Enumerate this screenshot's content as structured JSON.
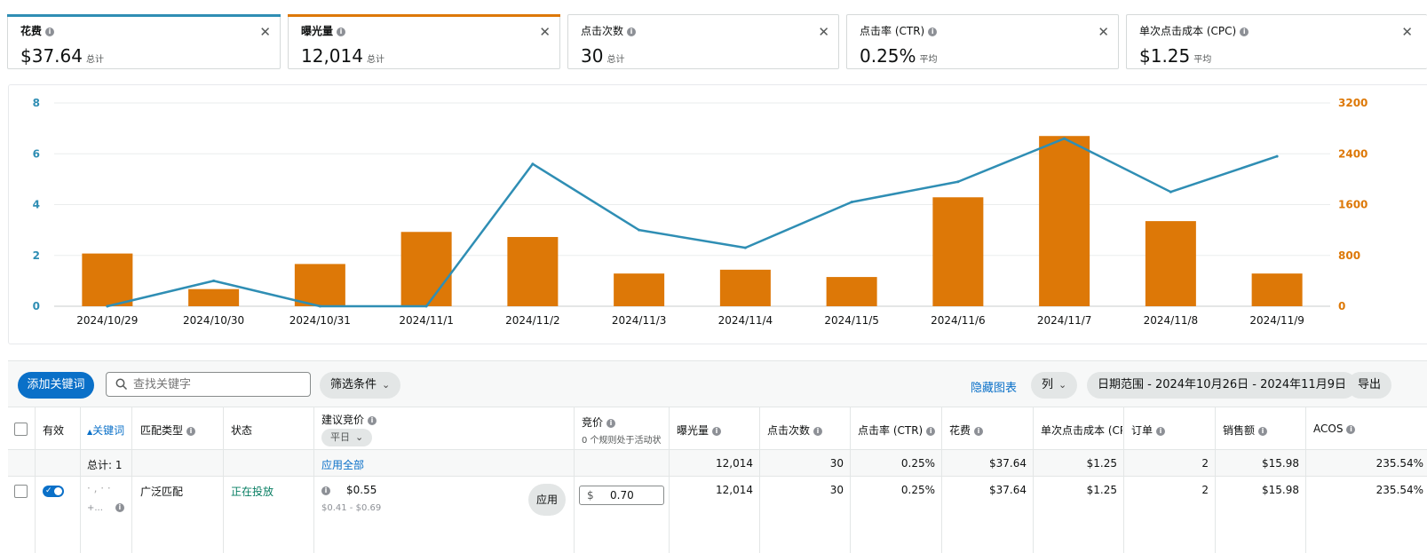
{
  "metrics": [
    {
      "label": "花费",
      "value": "$37.64",
      "unit": "总计",
      "accent": "#2f8eb4",
      "active": true
    },
    {
      "label": "曝光量",
      "value": "12,014",
      "unit": "总计",
      "accent": "#dd7807",
      "active": true
    },
    {
      "label": "点击次数",
      "value": "30",
      "unit": "总计",
      "accent": "",
      "active": false
    },
    {
      "label": "点击率 (CTR)",
      "value": "0.25%",
      "unit": "平均",
      "accent": "",
      "active": false
    },
    {
      "label": "单次点击成本 (CPC)",
      "value": "$1.25",
      "unit": "平均",
      "accent": "",
      "active": false
    }
  ],
  "chart_data": {
    "type": "bar",
    "categories": [
      "2024/10/29",
      "2024/10/30",
      "2024/10/31",
      "2024/11/1",
      "2024/11/2",
      "2024/11/3",
      "2024/11/4",
      "2024/11/5",
      "2024/11/6",
      "2024/11/7",
      "2024/11/8",
      "2024/11/9"
    ],
    "series": [
      {
        "name": "曝光量",
        "type": "bar",
        "axis": "right",
        "color": "#dd7807",
        "values": [
          830,
          270,
          665,
          1170,
          1090,
          515,
          575,
          460,
          1715,
          2680,
          1340,
          515
        ]
      },
      {
        "name": "花费",
        "type": "line",
        "axis": "left",
        "color": "#2f8eb4",
        "values": [
          0,
          1.0,
          0,
          0,
          5.6,
          3.0,
          2.3,
          4.1,
          4.9,
          6.6,
          4.5,
          5.9
        ]
      }
    ],
    "y_left": {
      "min": 0,
      "max": 8,
      "ticks": [
        0,
        2,
        4,
        6,
        8
      ]
    },
    "y_right": {
      "min": 0,
      "max": 3200,
      "ticks": [
        0,
        800,
        1600,
        2400,
        3200
      ]
    },
    "grid": true
  },
  "toolbar": {
    "add_keyword": "添加关键词",
    "search_placeholder": "查找关键字",
    "filter": "筛选条件",
    "hide_chart": "隐藏图表",
    "columns": "列",
    "date_range": "日期范围 - 2024年10月26日 - 2024年11月9日",
    "export": "导出"
  },
  "table": {
    "headers": {
      "active": "有效",
      "keyword": "关键词",
      "match_type": "匹配类型",
      "status": "状态",
      "suggested_bid": "建议竞价",
      "suggested_bid_dropdown": "平日",
      "bid": "竞价",
      "bid_sub": "0 个规则处于活动状",
      "impressions": "曝光量",
      "clicks": "点击次数",
      "ctr": "点击率 (CTR)",
      "spend": "花费",
      "cpc": "单次点击成本 (CPC",
      "orders": "订单",
      "sales": "销售额",
      "acos": "ACOS"
    },
    "totals": {
      "label": "总计: 1",
      "apply_all": "应用全部",
      "impressions": "12,014",
      "clicks": "30",
      "ctr": "0.25%",
      "spend": "$37.64",
      "cpc": "$1.25",
      "orders": "2",
      "sales": "$15.98",
      "acos": "235.54%"
    },
    "rows": [
      {
        "keyword": "· , · ·",
        "keyword_more": "+...",
        "match_type": "广泛匹配",
        "status": "正在投放",
        "suggested_bid": "$0.55",
        "suggested_range": "$0.41 - $0.69",
        "apply": "应用",
        "bid_currency": "$",
        "bid_value": "0.70",
        "impressions": "12,014",
        "clicks": "30",
        "ctr": "0.25%",
        "spend": "$37.64",
        "cpc": "$1.25",
        "orders": "2",
        "sales": "$15.98",
        "acos": "235.54%"
      }
    ]
  }
}
